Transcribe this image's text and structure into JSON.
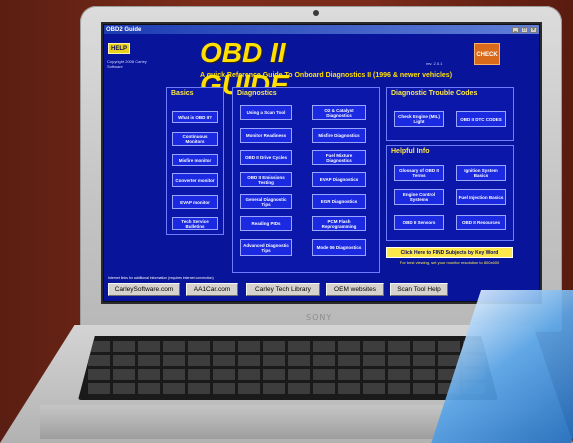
{
  "window": {
    "title": "OBD2 Guide"
  },
  "header": {
    "help_label": "HELP",
    "copyright": "Copyright 2008 Carley Software",
    "app_title": "OBD II GUIDE",
    "version": "rev. 2.0.1",
    "logo_text": "CHECK",
    "subtitle": "A quick Reference Guide To Onboard Diagnostics II (1996 & newer vehicles)"
  },
  "panels": {
    "basics": {
      "heading": "Basics",
      "buttons": [
        "What is OBD II?",
        "Continuous Monitors",
        "Misfire monitor",
        "Converter monitor",
        "EVAP monitor",
        "Tech Service Bulletins"
      ]
    },
    "diagnostics": {
      "heading": "Diagnostics",
      "left_buttons": [
        "Using a Scan Tool",
        "Monitor Readiness",
        "OBD II Drive Cycles",
        "OBD II Emissions Testing",
        "General Diagnostic Tips",
        "Reading PIDs",
        "Advanced Diagnostic Tips"
      ],
      "right_buttons": [
        "O2 & Catalyst Diagnostics",
        "Misfire Diagnostics",
        "Fuel Mixture Diagnostics",
        "EVAP Diagnostics",
        "EGR Diagnostics",
        "PCM Flash Reprogramming",
        "Mode 06 Diagnostics"
      ]
    },
    "dtc": {
      "heading": "Diagnostic Trouble Codes",
      "buttons": [
        "Check Engine (MIL) Light",
        "OBD II DTC CODES"
      ]
    },
    "helpful": {
      "heading": "Helpful Info",
      "buttons": [
        "Glossary of OBD II Terms",
        "Ignition System Basics",
        "Engine Control Systems",
        "Fuel Injection Basics",
        "OBD II Sensors",
        "OBD II Resources"
      ]
    }
  },
  "keyword_button": "Click Here to FIND Subjects by Key Word",
  "resolution_note": "For best viewing, set your monitor resolution to 800x600",
  "internet_note": "Internet links for additional information (requires internet connection)",
  "links": [
    "CarleySoftware.com",
    "AA1Car.com",
    "Carley Tech Library",
    "OEM websites",
    "Scan Tool Help"
  ],
  "laptop": {
    "brand": "SONY"
  },
  "colors": {
    "window_bg": "#08149a",
    "button_bg": "#1b2ae0",
    "accent_yellow": "#ffe000",
    "backdrop": "#7b2c1a"
  }
}
